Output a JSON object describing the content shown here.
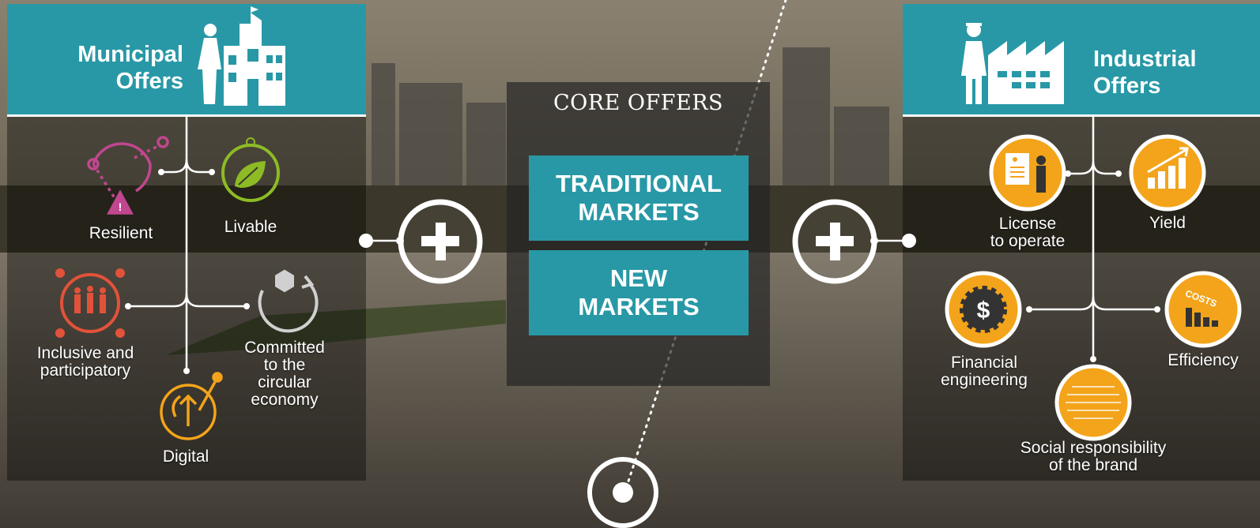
{
  "municipal": {
    "title_line1": "Municipal",
    "title_line2": "Offers",
    "items": [
      {
        "label": "Resilient",
        "icon": "resilient-icon",
        "color": "#c0478f"
      },
      {
        "label": "Livable",
        "icon": "leaf-icon",
        "color": "#8dbb25"
      },
      {
        "label_line1": "Inclusive and",
        "label_line2": "participatory",
        "icon": "people-icon",
        "color": "#e2523a"
      },
      {
        "label_line1": "Committed",
        "label_line2": "to the",
        "label_line3": "circular",
        "label_line4": "economy",
        "icon": "recycle-icon",
        "color": "#cfcfcf"
      },
      {
        "label": "Digital",
        "icon": "digital-icon",
        "color": "#f3a41b"
      }
    ]
  },
  "core": {
    "title": "CORE OFFERS",
    "traditional_line1": "TRADITIONAL",
    "traditional_line2": "MARKETS",
    "new_line1": "NEW",
    "new_line2": "MARKETS"
  },
  "industrial": {
    "title_line1": "Industrial",
    "title_line2": "Offers",
    "items": [
      {
        "label_line1": "License",
        "label_line2": "to operate",
        "icon": "license-icon"
      },
      {
        "label": "Yield",
        "icon": "yield-chart-icon"
      },
      {
        "label_line1": "Financial",
        "label_line2": "engineering",
        "icon": "dollar-gear-icon"
      },
      {
        "label": "Efficiency",
        "icon": "costs-chart-icon"
      },
      {
        "label_line1": "Social responsibility",
        "label_line2": "of the brand",
        "icon": "word-cloud-icon"
      }
    ],
    "icon_color": "#f3a41b"
  },
  "colors": {
    "teal": "#2898a6",
    "white": "#ffffff",
    "orange": "#f3a41b"
  }
}
